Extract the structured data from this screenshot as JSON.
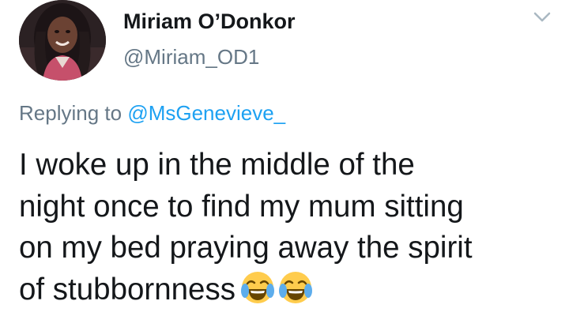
{
  "tweet": {
    "author": {
      "display_name": "Miriam O’Donkor",
      "handle": "@Miriam_OD1"
    },
    "reply": {
      "prefix": "Replying to",
      "mention": "@MsGenevieve_"
    },
    "text_lines": [
      "I woke up in the middle of the",
      "night once to find my mum sitting",
      "on my bed praying away the spirit",
      "of stubbornness"
    ],
    "emojis": [
      "face-with-tears-of-joy",
      "face-with-tears-of-joy"
    ],
    "icons": {
      "menu": "chevron-down-icon"
    },
    "colors": {
      "text": "#14171a",
      "secondary": "#657786",
      "link": "#1da1f2"
    }
  }
}
